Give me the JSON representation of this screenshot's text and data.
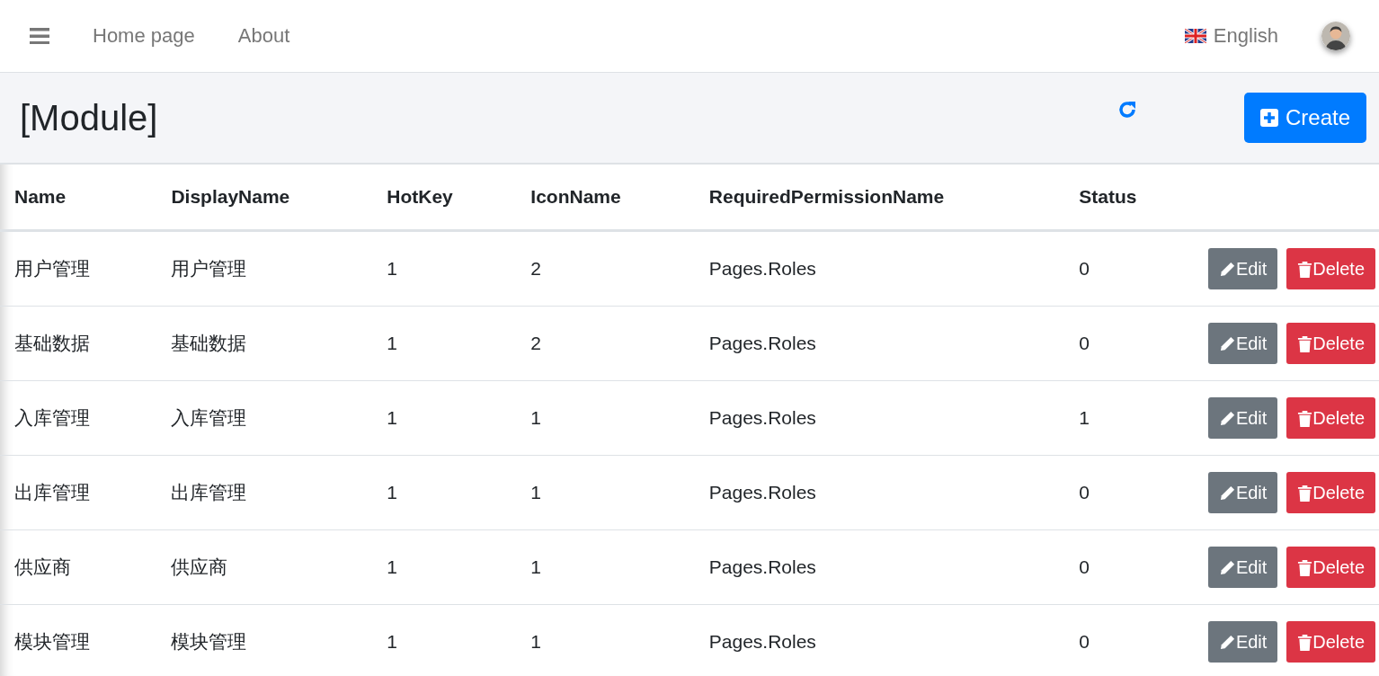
{
  "navbar": {
    "links": [
      "Home page",
      "About"
    ],
    "language": "English"
  },
  "header": {
    "title": "[Module]",
    "create_button": "Create"
  },
  "table": {
    "columns": [
      "Name",
      "DisplayName",
      "HotKey",
      "IconName",
      "RequiredPermissionName",
      "Status"
    ],
    "rows": [
      {
        "cells": [
          "用户管理",
          "用户管理",
          "1",
          "2",
          "Pages.Roles",
          "0"
        ],
        "edit": "Edit",
        "delete": "Delete"
      },
      {
        "cells": [
          "基础数据",
          "基础数据",
          "1",
          "2",
          "Pages.Roles",
          "0"
        ],
        "edit": "Edit",
        "delete": "Delete"
      },
      {
        "cells": [
          "入库管理",
          "入库管理",
          "1",
          "1",
          "Pages.Roles",
          "1"
        ],
        "edit": "Edit",
        "delete": "Delete"
      },
      {
        "cells": [
          "出库管理",
          "出库管理",
          "1",
          "1",
          "Pages.Roles",
          "0"
        ],
        "edit": "Edit",
        "delete": "Delete"
      },
      {
        "cells": [
          "供应商",
          "供应商",
          "1",
          "1",
          "Pages.Roles",
          "0"
        ],
        "edit": "Edit",
        "delete": "Delete"
      },
      {
        "cells": [
          "模块管理",
          "模块管理",
          "1",
          "1",
          "Pages.Roles",
          "0"
        ],
        "edit": "Edit",
        "delete": "Delete"
      }
    ]
  }
}
